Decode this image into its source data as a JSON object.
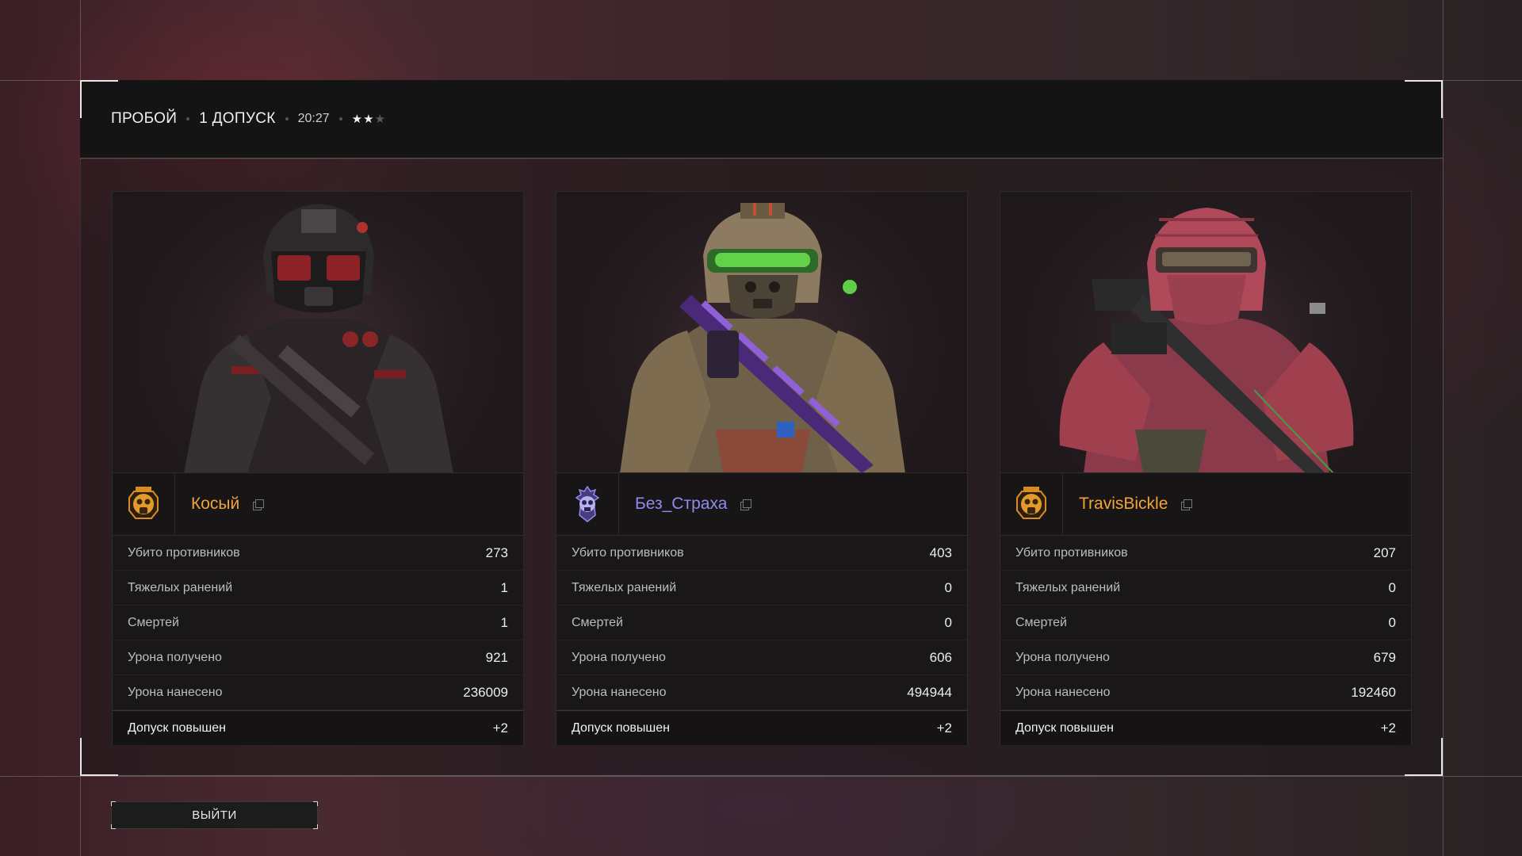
{
  "header": {
    "mode": "ПРОБОЙ",
    "clearance": "1 ДОПУСК",
    "time": "20:27",
    "stars_filled": 2,
    "stars_total": 3,
    "stars_text": "★★",
    "stars_empty_text": "★"
  },
  "players": [
    {
      "name": "Косый",
      "name_color": "#f0a43a",
      "emblem": "gas-mask-skull-emblem-gold",
      "stats": [
        {
          "label": "Убито противников",
          "value": "273"
        },
        {
          "label": "Тяжелых ранений",
          "value": "1"
        },
        {
          "label": "Смертей",
          "value": "1"
        },
        {
          "label": "Урона получено",
          "value": "921"
        },
        {
          "label": "Урона нанесено",
          "value": "236009"
        }
      ],
      "total": {
        "label": "Допуск повышен",
        "value": "+2"
      }
    },
    {
      "name": "Без_Страха",
      "name_color": "#8f8cf0",
      "emblem": "skull-emblem-purple",
      "stats": [
        {
          "label": "Убито противников",
          "value": "403"
        },
        {
          "label": "Тяжелых ранений",
          "value": "0"
        },
        {
          "label": "Смертей",
          "value": "0"
        },
        {
          "label": "Урона получено",
          "value": "606"
        },
        {
          "label": "Урона нанесено",
          "value": "494944"
        }
      ],
      "total": {
        "label": "Допуск повышен",
        "value": "+2"
      }
    },
    {
      "name": "TravisBickle",
      "name_color": "#f0a43a",
      "emblem": "gas-mask-skull-emblem-gold",
      "stats": [
        {
          "label": "Убито противников",
          "value": "207"
        },
        {
          "label": "Тяжелых ранений",
          "value": "0"
        },
        {
          "label": "Смертей",
          "value": "0"
        },
        {
          "label": "Урона получено",
          "value": "679"
        },
        {
          "label": "Урона нанесено",
          "value": "192460"
        }
      ],
      "total": {
        "label": "Допуск повышен",
        "value": "+2"
      }
    }
  ],
  "exit_button": "ВЫЙТИ"
}
